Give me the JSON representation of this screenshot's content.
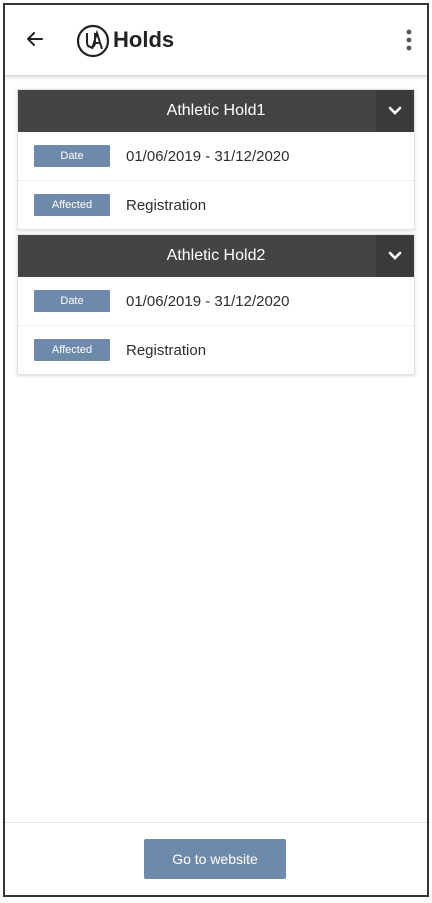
{
  "header": {
    "title": "Holds",
    "back_icon": "arrow-left-icon",
    "logo_icon": "ua-logo-icon",
    "menu_icon": "kebab-menu-icon"
  },
  "holds": [
    {
      "title": "Athletic Hold1",
      "date_label": "Date",
      "date_value": "01/06/2019 - 31/12/2020",
      "affected_label": "Affected",
      "affected_value": "Registration"
    },
    {
      "title": "Athletic Hold2",
      "date_label": "Date",
      "date_value": "01/06/2019 - 31/12/2020",
      "affected_label": "Affected",
      "affected_value": "Registration"
    }
  ],
  "footer": {
    "button_label": "Go to website"
  },
  "colors": {
    "header_bg": "#444446",
    "badge": "#6e8aab",
    "button": "#6e8aab"
  }
}
